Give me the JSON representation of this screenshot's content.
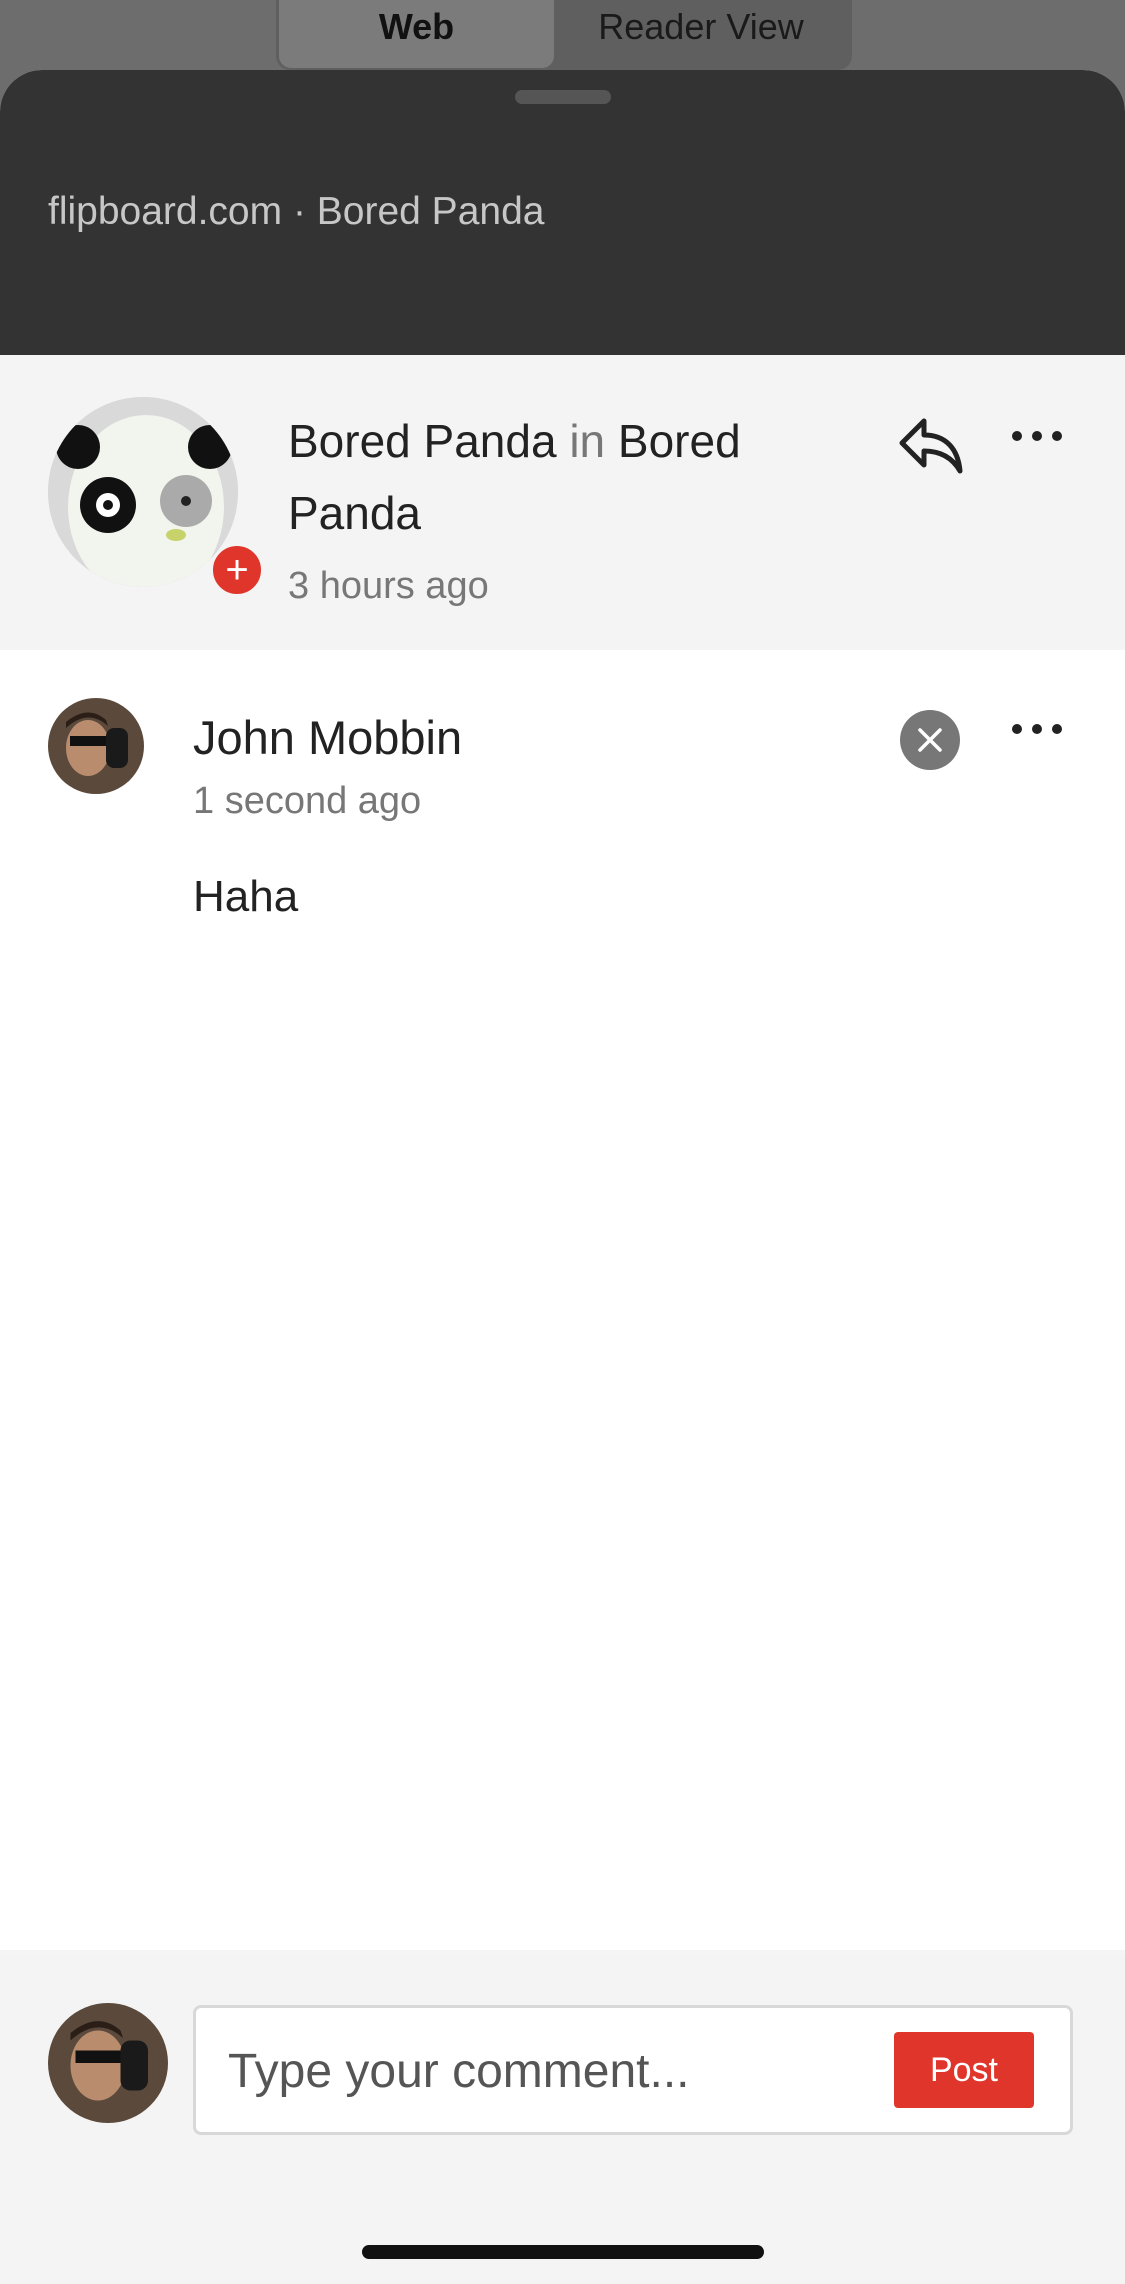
{
  "segmented": {
    "web": "Web",
    "reader": "Reader View"
  },
  "sheet": {
    "source": "flipboard.com · Bored Panda"
  },
  "post": {
    "author": "Bored Panda",
    "in_word": "in",
    "magazine": "Bored Panda",
    "time": "3 hours ago"
  },
  "comment": {
    "name": "John Mobbin",
    "time": "1 second ago",
    "text": "Haha"
  },
  "composer": {
    "placeholder": "Type your comment...",
    "post_label": "Post"
  },
  "colors": {
    "accent": "#e0352b",
    "header": "#333333"
  },
  "icons": {
    "reply": "reply-icon",
    "more": "more-icon",
    "close": "close-icon",
    "add": "plus-icon"
  }
}
